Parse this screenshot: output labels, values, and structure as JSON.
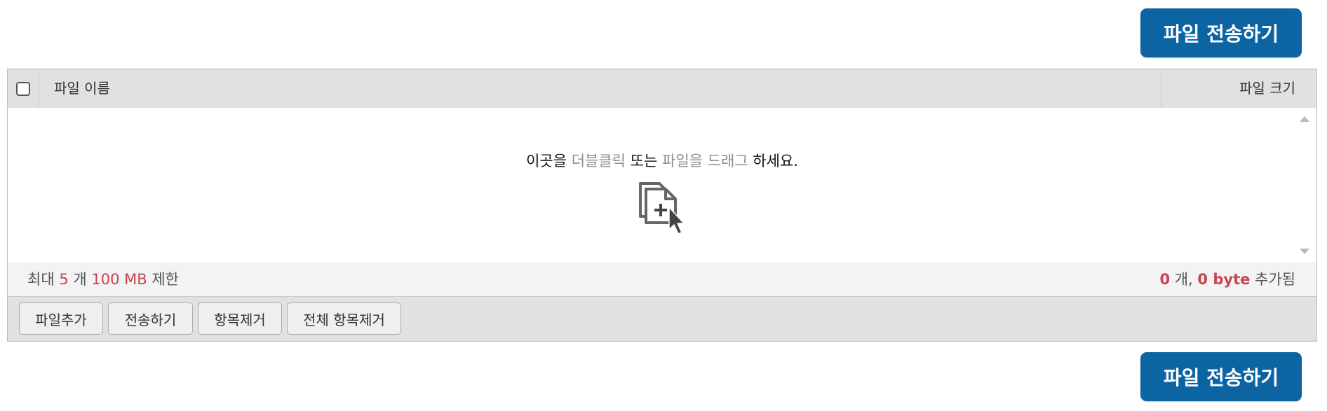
{
  "actions": {
    "send_label": "파일 전송하기"
  },
  "header": {
    "name_col": "파일 이름",
    "size_col": "파일 크기"
  },
  "drop_area": {
    "msg_part1": "이곳을 ",
    "msg_em1": "더블클릭",
    "msg_part2": " 또는 ",
    "msg_em2": "파일을 드래그",
    "msg_part3": " 하세요.",
    "icon": "add-files-icon"
  },
  "limits": {
    "prefix": "최대 ",
    "max_count": "5",
    "count_unit": " 개 ",
    "max_size": "100 MB",
    "suffix": " 제한"
  },
  "summary": {
    "count": "0",
    "count_unit": " 개, ",
    "bytes": "0 byte",
    "suffix": " 추가됨"
  },
  "toolbar": {
    "add_label": "파일추가",
    "send_label": "전송하기",
    "remove_label": "항목제거",
    "remove_all_label": "전체 항목제거"
  },
  "colors": {
    "primary": "#0d64a3",
    "highlight": "#c8444f"
  }
}
